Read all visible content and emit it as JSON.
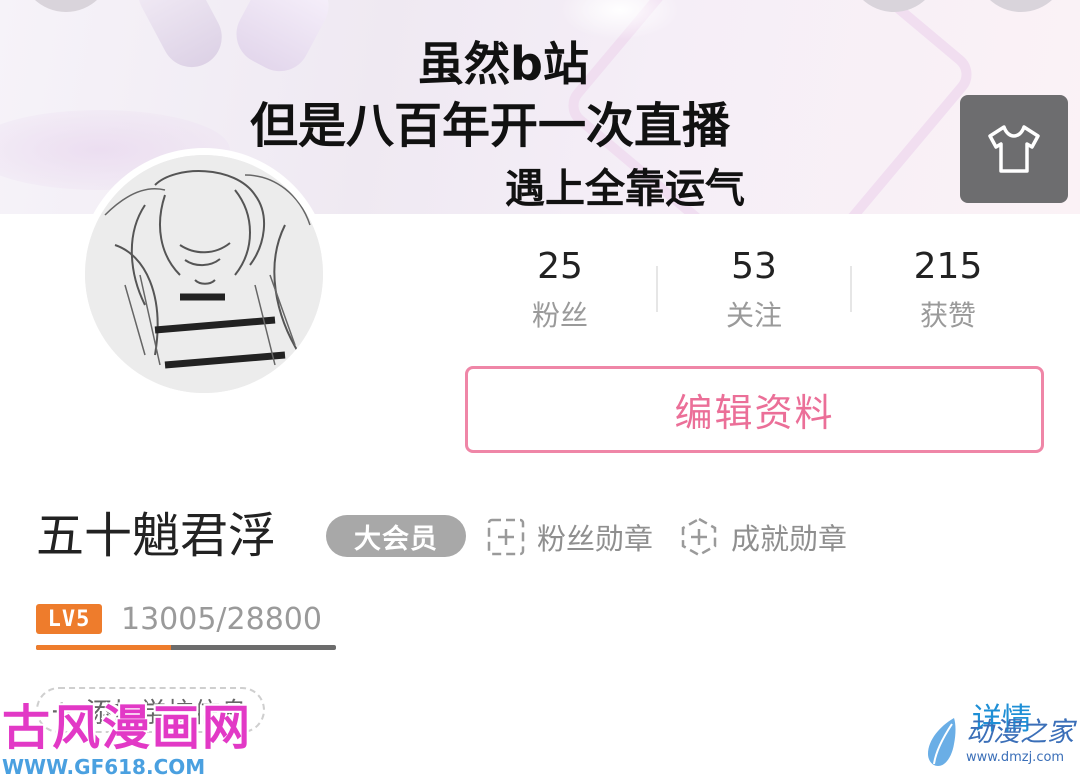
{
  "banner": {
    "line1": "虽然b站",
    "line2": "但是八百年开一次直播",
    "line3": "遇上全靠运气",
    "skin_icon": "tshirt-icon"
  },
  "stats": [
    {
      "value": "25",
      "label": "粉丝"
    },
    {
      "value": "53",
      "label": "关注"
    },
    {
      "value": "215",
      "label": "获赞"
    }
  ],
  "edit_profile_label": "编辑资料",
  "profile": {
    "username": "五十魈君浮",
    "vip_label": "大会员",
    "fan_medal_label": "粉丝勋章",
    "achievement_medal_label": "成就勋章"
  },
  "level": {
    "badge": "LV5",
    "exp_text": "13005/28800",
    "progress": 0.4516
  },
  "school_label": "添加学校信息",
  "details_label": "详情",
  "watermarks": {
    "left_title": "古风漫画网",
    "left_url": "WWW.GF618.COM",
    "right_title": "动漫之家",
    "right_url": "www.dmzj.com"
  },
  "colors": {
    "accent_pink": "#eb6f98",
    "level_orange": "#ee7c2c",
    "link_blue": "#1e8fd6"
  }
}
